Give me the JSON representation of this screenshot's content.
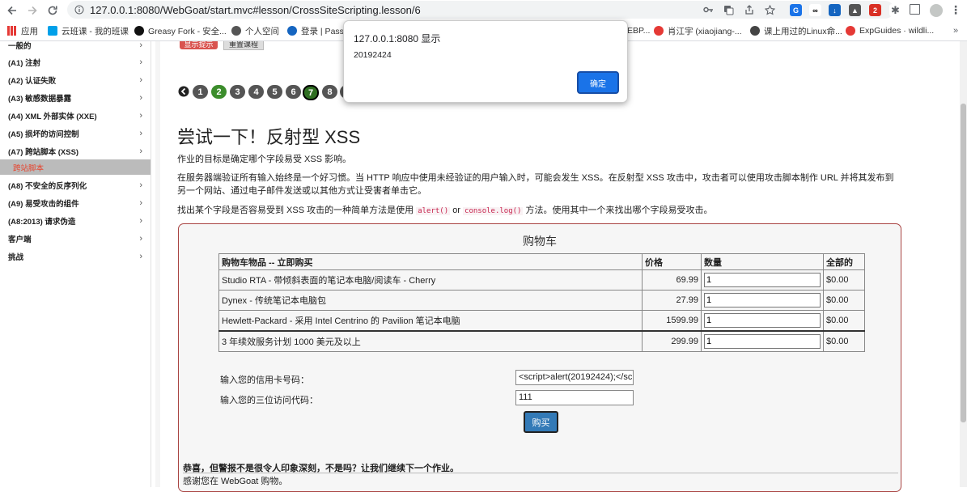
{
  "browser": {
    "url": "127.0.0.1:8080/WebGoat/start.mvc#lesson/CrossSiteScripting.lesson/6"
  },
  "bookmarks": [
    {
      "label": "应用",
      "color": "#1a73e8"
    },
    {
      "label": "云班课 - 我的班课",
      "color": "#00a0e9"
    },
    {
      "label": "Greasy Fork - 安全...",
      "color": "#111111"
    },
    {
      "label": "个人空间",
      "color": "#555555"
    },
    {
      "label": "登录 | Passp",
      "color": "#1565c0"
    },
    {
      "label": "EBP...",
      "color": "#ffffff"
    },
    {
      "label": "肖江宇 (xiaojiang-...",
      "color": "#e53935"
    },
    {
      "label": "课上用过的Linux命...",
      "color": "#444444"
    },
    {
      "label": "ExpGuides · wildli...",
      "color": "#e53935"
    }
  ],
  "sidebar": {
    "items": [
      {
        "label": "一般的"
      },
      {
        "label": "(A1) 注射"
      },
      {
        "label": "(A2) 认证失败"
      },
      {
        "label": "(A3) 敏感数据暴露"
      },
      {
        "label": "(A4) XML 外部实体 (XXE)"
      },
      {
        "label": "(A5) 损坏的访问控制"
      },
      {
        "label": "(A7) 跨站脚本 (XSS)"
      },
      {
        "label": "(A8) 不安全的反序列化"
      },
      {
        "label": "(A9) 易受攻击的组件"
      },
      {
        "label": "(A8:2013) 请求伪造"
      },
      {
        "label": "客户端"
      },
      {
        "label": "挑战"
      }
    ],
    "active_sub": "跨站脚本"
  },
  "lesson": {
    "show_hints": "显示提示",
    "reset": "重置课程",
    "pages": [
      "1",
      "2",
      "3",
      "4",
      "5",
      "6",
      "7",
      "8",
      "9"
    ],
    "current_page": "7",
    "title": "尝试一下！反射型 XSS",
    "p1": "作业的目标是确定哪个字段易受 XSS 影响。",
    "p2": "在服务器端验证所有输入始终是一个好习惯。当 HTTP 响应中使用未经验证的用户输入时，可能会发生 XSS。在反射型 XSS 攻击中，攻击者可以使用攻击脚本制作 URL 并将其发布到另一个网站、通过电子邮件发送或以其他方式让受害者单击它。",
    "p3_a": "找出某个字段是否容易受到 XSS 攻击的一种简单方法是使用",
    "p3_code1": "alert()",
    "p3_or": "or",
    "p3_code2": "console.log()",
    "p3_b": "方法。使用其中一个来找出哪个字段易受攻击。"
  },
  "cart": {
    "title": "购物车",
    "headers": [
      "购物车物品 -- 立即购买",
      "价格",
      "数量",
      "全部的"
    ],
    "rows": [
      {
        "item": "Studio RTA - 带倾斜表面的笔记本电脑/阅读车 - Cherry",
        "price": "69.99",
        "qty": "1",
        "total": "$0.00"
      },
      {
        "item": "Dynex - 传统笔记本电脑包",
        "price": "27.99",
        "qty": "1",
        "total": "$0.00"
      },
      {
        "item": "Hewlett-Packard - 采用 Intel Centrino 的 Pavilion 笔记本电脑",
        "price": "1599.99",
        "qty": "1",
        "total": "$0.00"
      },
      {
        "item": "3 年续效服务计划 1000 美元及以上",
        "price": "299.99",
        "qty": "1",
        "total": "$0.00"
      }
    ],
    "card_label": "输入您的信用卡号码：",
    "card_value": "<script>alert(20192424);</sc",
    "code_label": "输入您的三位访问代码：",
    "code_value": "111",
    "buy": "购买",
    "feedback": "恭喜，但警报不是很令人印象深刻，不是吗？让我们继续下一个作业。",
    "feedback2": "感谢您在 WebGoat 购物。"
  },
  "dialog": {
    "title": "127.0.0.1:8080 显示",
    "message": "20192424",
    "ok": "确定"
  }
}
